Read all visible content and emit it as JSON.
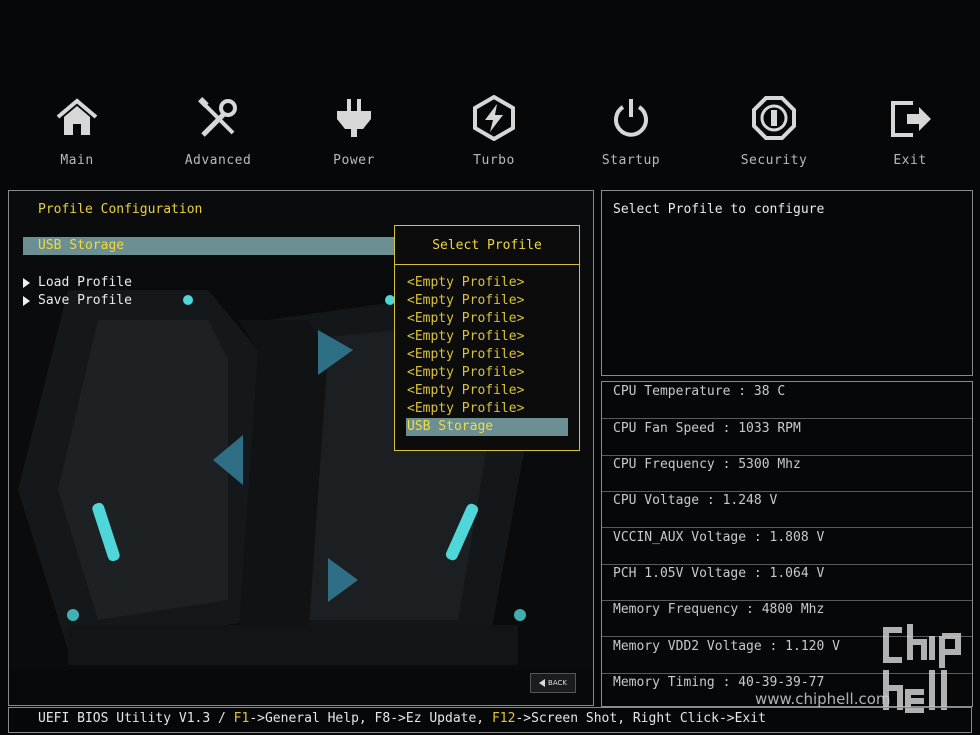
{
  "nav": {
    "items": [
      {
        "label": "Main",
        "icon": "home-icon"
      },
      {
        "label": "Advanced",
        "icon": "tools-icon"
      },
      {
        "label": "Power",
        "icon": "power-plug-icon"
      },
      {
        "label": "Turbo",
        "icon": "turbo-bolt-icon"
      },
      {
        "label": "Startup",
        "icon": "startup-power-icon"
      },
      {
        "label": "Security",
        "icon": "security-shield-icon"
      },
      {
        "label": "Exit",
        "icon": "exit-icon"
      }
    ]
  },
  "left_panel": {
    "heading": "Profile Configuration",
    "usb_storage": "USB Storage",
    "items": [
      "Load Profile",
      "Save Profile"
    ]
  },
  "popup": {
    "title": "Select Profile",
    "options": [
      "<Empty Profile>",
      "<Empty Profile>",
      "<Empty Profile>",
      "<Empty Profile>",
      "<Empty Profile>",
      "<Empty Profile>",
      "<Empty Profile>",
      "<Empty Profile>",
      "USB Storage"
    ],
    "selected_index": 8
  },
  "help": {
    "text": "Select Profile to configure"
  },
  "hardware": [
    "CPU Temperature : 38 C",
    "CPU Fan Speed : 1033 RPM",
    "CPU Frequency : 5300 Mhz",
    "CPU Voltage : 1.248 V",
    "VCCIN_AUX Voltage : 1.808 V",
    "PCH 1.05V Voltage : 1.064 V",
    "Memory Frequency : 4800 Mhz",
    "Memory VDD2 Voltage : 1.120 V",
    "Memory Timing : 40-39-39-77"
  ],
  "back_button": {
    "label": "BACK"
  },
  "watermark": {
    "url": "www.chiphell.com",
    "logo_text": "chip hell"
  },
  "statusbar": {
    "prefix": "UEFI BIOS Utility V1.3 / ",
    "f1": "F1",
    "part2": "->General Help, F8->Ez Update, ",
    "f12": "F12",
    "part3": "->Screen Shot, Right Click->Exit"
  },
  "colors": {
    "accent_yellow": "#e8d23a",
    "selection": "#6b8f93",
    "neon_cyan": "#4fd6d8",
    "border": "#8a8a8a"
  }
}
